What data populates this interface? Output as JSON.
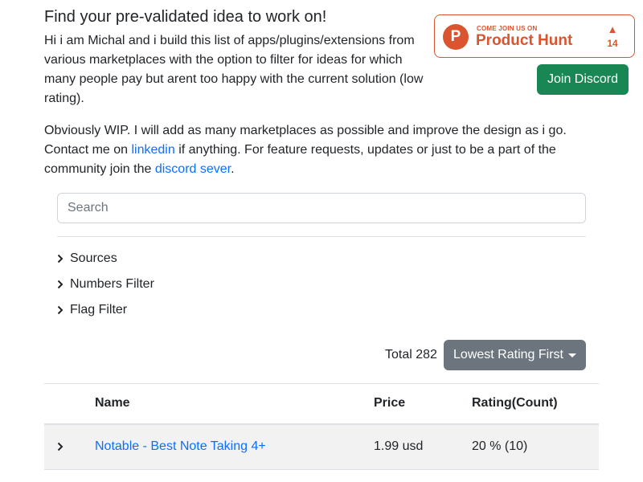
{
  "header": {
    "title": "Find your pre-validated idea to work on!",
    "intro": "Hi i am Michal and i build this list of apps/plugins/extensions from various marketplaces with the option to filter for ideas for which many people pay but arent too happy with the current solution (low rating).",
    "contact_pre": "Obviously WIP. I will add as many marketplaces as possible and improve the design as i go. Contact me on ",
    "linkedin_label": "linkedin",
    "contact_mid": " if anything. For feature requests, updates or just to be a part of the community join the ",
    "discord_link_label": "discord sever",
    "contact_post": "."
  },
  "product_hunt": {
    "tagline": "COME JOIN US ON",
    "name": "Product Hunt",
    "logo_letter": "P",
    "upvote_arrow": "▲",
    "upvotes": "14",
    "brand_color": "#da552f"
  },
  "discord_button": {
    "label": "Join Discord",
    "color": "#198754"
  },
  "search": {
    "placeholder": "Search",
    "value": ""
  },
  "filters": [
    {
      "label": "Sources",
      "icon": "chevron-right-icon"
    },
    {
      "label": "Numbers Filter",
      "icon": "chevron-right-icon"
    },
    {
      "label": "Flag Filter",
      "icon": "chevron-right-icon"
    }
  ],
  "results": {
    "total_label": "Total 282",
    "sort_label": "Lowest Rating First"
  },
  "table": {
    "columns": [
      "",
      "Name",
      "Price",
      "Rating(Count)"
    ],
    "rows": [
      {
        "name": "Notable - Best Note Taking 4+",
        "price": "1.99 usd",
        "rating": "20 % (10)"
      }
    ]
  }
}
